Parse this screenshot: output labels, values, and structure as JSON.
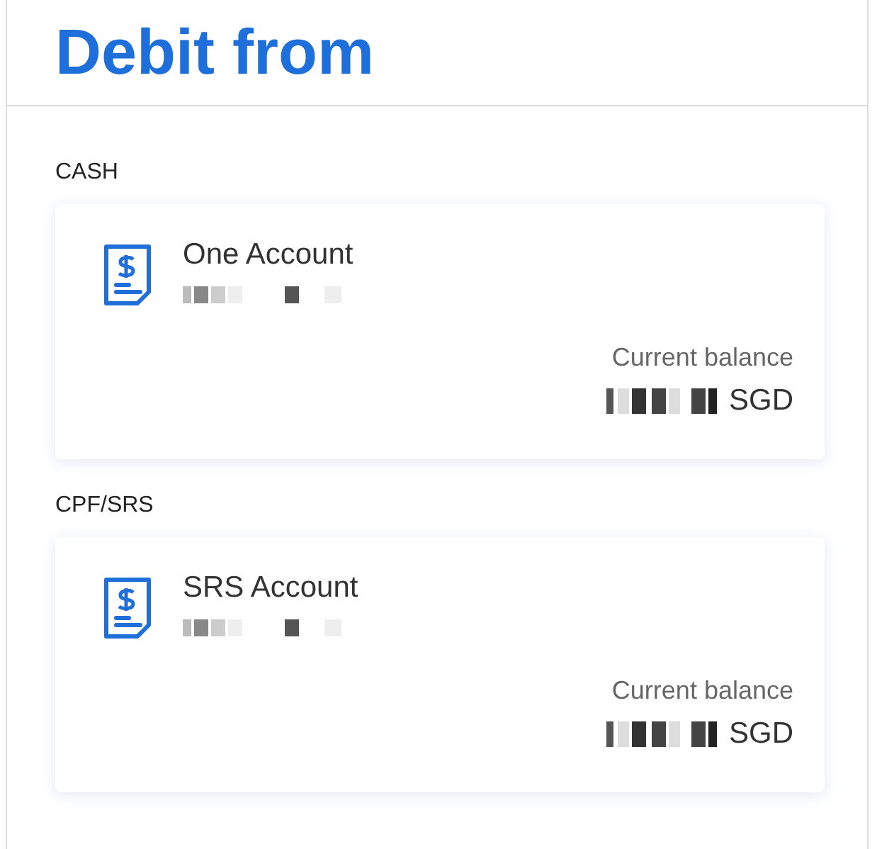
{
  "header": {
    "title": "Debit from"
  },
  "sections": [
    {
      "label": "CASH",
      "accounts": [
        {
          "name": "One Account",
          "number_hidden": true,
          "balance_label": "Current balance",
          "amount_hidden": true,
          "currency": "SGD"
        }
      ]
    },
    {
      "label": "CPF/SRS",
      "accounts": [
        {
          "name": "SRS Account",
          "number_hidden": true,
          "balance_label": "Current balance",
          "amount_hidden": true,
          "currency": "SGD"
        }
      ]
    }
  ]
}
